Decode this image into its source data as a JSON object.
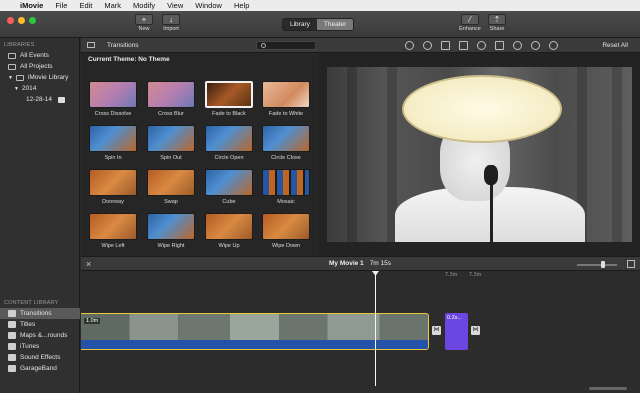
{
  "menubar": {
    "apple": "",
    "items": [
      "iMovie",
      "File",
      "Edit",
      "Mark",
      "Modify",
      "View",
      "Window",
      "Help"
    ]
  },
  "toolbar": {
    "new_label": "New",
    "import_label": "Import",
    "library_label": "Library",
    "theater_label": "Theater",
    "enhance_label": "Enhance",
    "share_label": "Share"
  },
  "libraries": {
    "header": "LIBRARIES",
    "items": [
      "All Events",
      "All Projects",
      "iMovie Library",
      "2014",
      "12-28-14"
    ]
  },
  "content_library": {
    "header": "CONTENT LIBRARY",
    "items": [
      "Transitions",
      "Titles",
      "Maps &...rounds",
      "iTunes",
      "Sound Effects",
      "GarageBand"
    ]
  },
  "browser": {
    "title": "Transitions",
    "current_theme": "Current Theme: No Theme",
    "tiles": [
      "Cross Dissolve",
      "Cross Blur",
      "Fade to Black",
      "Fade to White",
      "Spin In",
      "Spin Out",
      "Circle Open",
      "Circle Close",
      "Doorway",
      "Swap",
      "Cube",
      "Mosaic",
      "Wipe Left",
      "Wipe Right",
      "Wipe Up",
      "Wipe Down"
    ]
  },
  "viewer": {
    "reset_all": "Reset All"
  },
  "timeline": {
    "project_name": "My Movie 1",
    "duration": "7m 15s",
    "tick_1": "7.2m",
    "tick_2": "7.2m",
    "clip_label": "1.0m",
    "purple_label": "0.2s..."
  },
  "colors": {
    "clip_border": "#e9c93a",
    "audio": "#2452a8",
    "title_clip": "#6b46e0"
  }
}
